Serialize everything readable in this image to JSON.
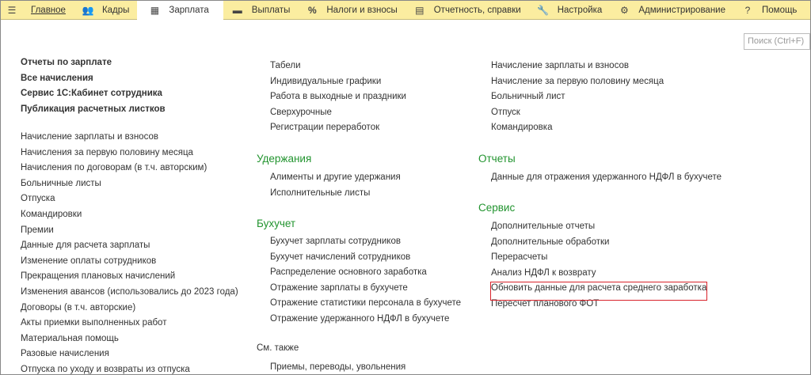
{
  "nav": {
    "menu_icon": "hamburger-icon",
    "tabs": [
      {
        "label": "Главное",
        "icon": ""
      },
      {
        "label": "Кадры",
        "icon": "people-icon"
      },
      {
        "label": "Зарплата",
        "icon": "calculator-icon"
      },
      {
        "label": "Выплаты",
        "icon": "wallet-icon"
      },
      {
        "label": "Налоги и взносы",
        "icon": "percent-icon"
      },
      {
        "label": "Отчетность, справки",
        "icon": "reports-icon"
      },
      {
        "label": "Настройка",
        "icon": "wrench-icon"
      },
      {
        "label": "Администрирование",
        "icon": "gear-icon"
      },
      {
        "label": "Помощь",
        "icon": "help-icon"
      }
    ]
  },
  "search": {
    "placeholder": "Поиск (Ctrl+F)"
  },
  "left": {
    "bold": [
      "Отчеты по зарплате",
      "Все начисления",
      "Сервис 1С:Кабинет сотрудника",
      "Публикация расчетных листков"
    ],
    "items": [
      "Начисление зарплаты и взносов",
      "Начисления за первую половину месяца",
      "Начисления по договорам (в т.ч. авторским)",
      "Больничные листы",
      "Отпуска",
      "Командировки",
      "Премии",
      "Данные для расчета зарплаты",
      "Изменение оплаты сотрудников",
      "Прекращения плановых начислений",
      "Изменения авансов (использовались до 2023 года)",
      "Договоры (в т.ч. авторские)",
      "Акты приемки выполненных работ",
      "Материальная помощь",
      "Разовые начисления",
      "Отпуска по уходу и возвраты из отпуска"
    ]
  },
  "middle": {
    "top": [
      "Табели",
      "Индивидуальные графики",
      "Работа в выходные и праздники",
      "Сверхурочные",
      "Регистрации переработок"
    ],
    "deductions": {
      "title": "Удержания",
      "items": [
        "Алименты и другие удержания",
        "Исполнительные листы"
      ]
    },
    "accounting": {
      "title": "Бухучет",
      "items": [
        "Бухучет зарплаты сотрудников",
        "Бухучет начислений сотрудников",
        "Распределение основного заработка",
        "Отражение зарплаты в бухучете",
        "Отражение статистики персонала в бухучете",
        "Отражение удержанного НДФЛ в бухучете"
      ]
    },
    "see_also": {
      "title": "См. также",
      "items": [
        "Приемы, переводы, увольнения"
      ]
    }
  },
  "right": {
    "top": [
      "Начисление зарплаты и взносов",
      "Начисление за первую половину месяца",
      "Больничный лист",
      "Отпуск",
      "Командировка"
    ],
    "reports": {
      "title": "Отчеты",
      "items": [
        "Данные для отражения удержанного НДФЛ в бухучете"
      ]
    },
    "service": {
      "title": "Сервис",
      "items": [
        "Дополнительные отчеты",
        "Дополнительные обработки",
        "Перерасчеты",
        "Анализ НДФЛ к возврату",
        "Обновить данные для расчета среднего заработка",
        "Пересчет планового ФОТ"
      ]
    }
  }
}
